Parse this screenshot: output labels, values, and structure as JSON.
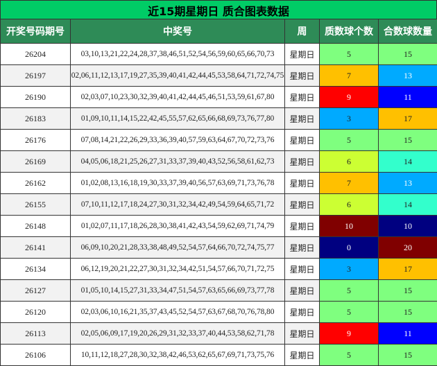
{
  "title": "近15期星期日 质合图表数据",
  "headers": [
    "开奖号码期号",
    "中奖号",
    "周",
    "质数球个数",
    "合数球数量"
  ],
  "colors": {
    "p0": "#000080",
    "p3": "#00aaff",
    "p5": "#7fff7f",
    "p6": "#ccff33",
    "p7": "#ffc000",
    "p9": "#ff0000",
    "p10": "#800000",
    "c10": "#000080",
    "c11": "#0000ff",
    "c13": "#00aaff",
    "c14": "#33ffcc",
    "c15": "#7fff7f",
    "c17": "#ffc000",
    "c20": "#800000"
  },
  "rows": [
    {
      "issue": "26204",
      "numbers": "03,10,13,21,22,24,28,37,38,46,51,52,54,56,59,60,65,66,70,73",
      "week": "星期日",
      "prime": "5",
      "composite": "15"
    },
    {
      "issue": "26197",
      "numbers": "02,06,11,12,13,17,19,27,35,39,40,41,42,44,45,53,58,64,71,72,74,75",
      "week": "星期日",
      "prime": "7",
      "composite": "13"
    },
    {
      "issue": "26190",
      "numbers": "02,03,07,10,23,30,32,39,40,41,42,44,45,46,51,53,59,61,67,80",
      "week": "星期日",
      "prime": "9",
      "composite": "11"
    },
    {
      "issue": "26183",
      "numbers": "01,09,10,11,14,15,22,42,45,55,57,62,65,66,68,69,73,76,77,80",
      "week": "星期日",
      "prime": "3",
      "composite": "17"
    },
    {
      "issue": "26176",
      "numbers": "07,08,14,21,22,26,29,33,36,39,40,57,59,63,64,67,70,72,73,76",
      "week": "星期日",
      "prime": "5",
      "composite": "15"
    },
    {
      "issue": "26169",
      "numbers": "04,05,06,18,21,25,26,27,31,33,37,39,40,43,52,56,58,61,62,73",
      "week": "星期日",
      "prime": "6",
      "composite": "14"
    },
    {
      "issue": "26162",
      "numbers": "01,02,08,13,16,18,19,30,33,37,39,40,56,57,63,69,71,73,76,78",
      "week": "星期日",
      "prime": "7",
      "composite": "13"
    },
    {
      "issue": "26155",
      "numbers": "07,10,11,12,17,18,24,27,30,31,32,34,42,49,54,59,64,65,71,72",
      "week": "星期日",
      "prime": "6",
      "composite": "14"
    },
    {
      "issue": "26148",
      "numbers": "01,02,07,11,17,18,26,28,30,38,41,42,43,54,59,62,69,71,74,79",
      "week": "星期日",
      "prime": "10",
      "composite": "10"
    },
    {
      "issue": "26141",
      "numbers": "06,09,10,20,21,28,33,38,48,49,52,54,57,64,66,70,72,74,75,77",
      "week": "星期日",
      "prime": "0",
      "composite": "20"
    },
    {
      "issue": "26134",
      "numbers": "06,12,19,20,21,22,27,30,31,32,34,42,51,54,57,66,70,71,72,75",
      "week": "星期日",
      "prime": "3",
      "composite": "17"
    },
    {
      "issue": "26127",
      "numbers": "01,05,10,14,15,27,31,33,34,47,51,54,57,63,65,66,69,73,77,78",
      "week": "星期日",
      "prime": "5",
      "composite": "15"
    },
    {
      "issue": "26120",
      "numbers": "02,03,06,10,16,21,35,37,43,45,52,54,57,63,67,68,70,76,78,80",
      "week": "星期日",
      "prime": "5",
      "composite": "15"
    },
    {
      "issue": "26113",
      "numbers": "02,05,06,09,17,19,20,26,29,31,32,33,37,40,44,53,58,62,71,78",
      "week": "星期日",
      "prime": "9",
      "composite": "11"
    },
    {
      "issue": "26106",
      "numbers": "10,11,12,18,27,28,30,32,38,42,46,53,62,65,67,69,71,73,75,76",
      "week": "星期日",
      "prime": "5",
      "composite": "15"
    }
  ]
}
